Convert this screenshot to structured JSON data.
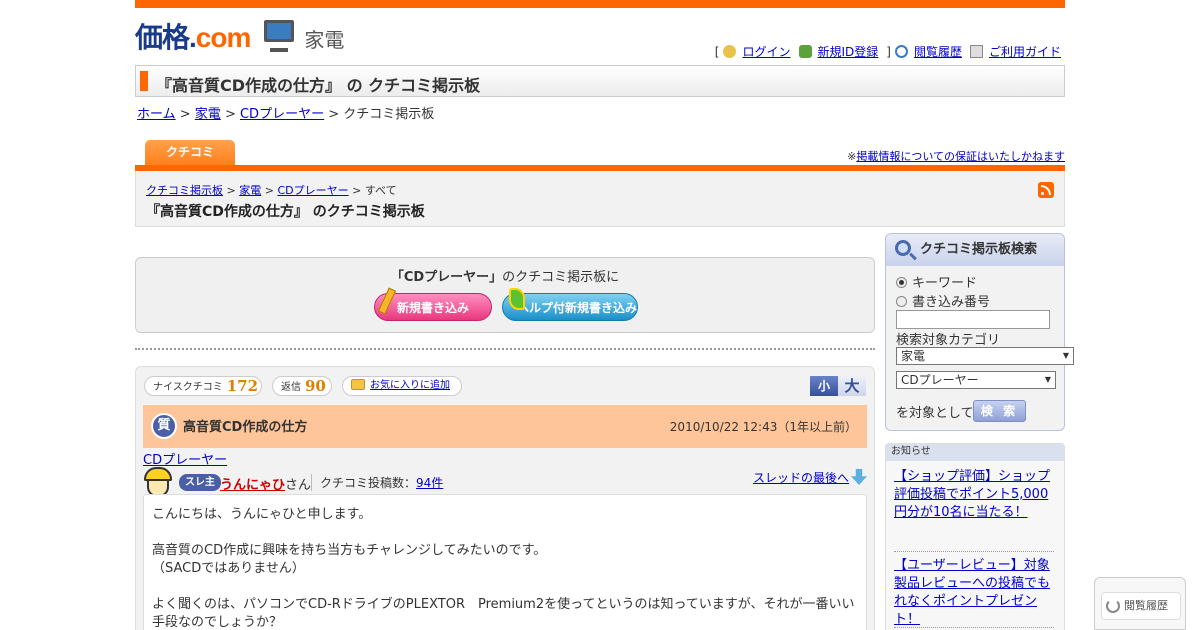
{
  "logo": {
    "main": "価格",
    "dot": ".",
    "com": "com",
    "sub": "家電"
  },
  "userlinks": {
    "open": "[",
    "login": "ログイン",
    "register": "新規ID登録",
    "close": "]",
    "history": "閲覧履歴",
    "guide": "ご利用ガイド"
  },
  "page_title": "『高音質CD作成の仕方』 の クチコミ掲示板",
  "breadcrumb": {
    "home": "ホーム",
    "sep": " > ",
    "cat": "家電",
    "sub": "CDプレーヤー",
    "current": "クチコミ掲示板"
  },
  "tab": "クチコミ",
  "disclaimer": {
    "mark": "※",
    "link": "掲載情報についての保証はいたしかねます"
  },
  "subheader": {
    "crumb1": "クチコミ掲示板",
    "crumb2": "家電",
    "crumb3": "CDプレーヤー",
    "crumb4": "すべて",
    "sep": " > ",
    "title": "『高音質CD作成の仕方』 のクチコミ掲示板"
  },
  "postbox": {
    "lead_quote": "「CDプレーヤー」",
    "lead_rest": "のクチコミ掲示板に",
    "new_btn": "新規書き込み",
    "help_btn": "ヘルプ付新規書き込み"
  },
  "thread": {
    "nice_label": "ナイスクチコミ",
    "nice_count": "172",
    "reply_label": "返信",
    "reply_count": "90",
    "fav_label": "お気に入りに追加",
    "fs_small": "小",
    "fs_large": "大",
    "q_icon": "質",
    "q_title": "高音質CD作成の仕方",
    "q_date": "2010/10/22 12:43（1年以上前）",
    "category": "CDプレーヤー",
    "tag": "スレ主",
    "user": "うんにゃひ",
    "user_suffix": "さん",
    "posts_label": "クチコミ投稿数：",
    "posts_count": "94件",
    "last_link": "スレッドの最後へ",
    "body": [
      "こんにちは、うんにゃひと申します。",
      "高音質のCD作成に興味を持ち当方もチャレンジしてみたいのです。",
      "（SACDではありません）",
      "よく聞くのは、パソコンでCD-RドライブのPLEXTOR　Premium2を使ってというのは知っていますが、それが一番いい",
      "手段なのでしょうか？"
    ]
  },
  "search": {
    "title": "クチコミ掲示板検索",
    "radio_kw": "キーワード",
    "radio_no": "書き込み番号",
    "cat_label": "検索対象カテゴリ",
    "sel1": "家電",
    "sel2": "CDプレーヤー",
    "target": "を対象として",
    "btn": "検 索"
  },
  "notice": {
    "title": "お知らせ",
    "n1": "【ショップ評価】ショップ評価投稿でポイント5,000円分が10名に当たる！",
    "n2": "【ユーザーレビュー】対象製品レビューへの投稿でもれなくポイントプレゼント！"
  },
  "history_btn": "閲覧履歴",
  "colors": {
    "brand_orange": "#ff6600",
    "link": "#0000cc",
    "question_bar": "#ffc59a"
  }
}
